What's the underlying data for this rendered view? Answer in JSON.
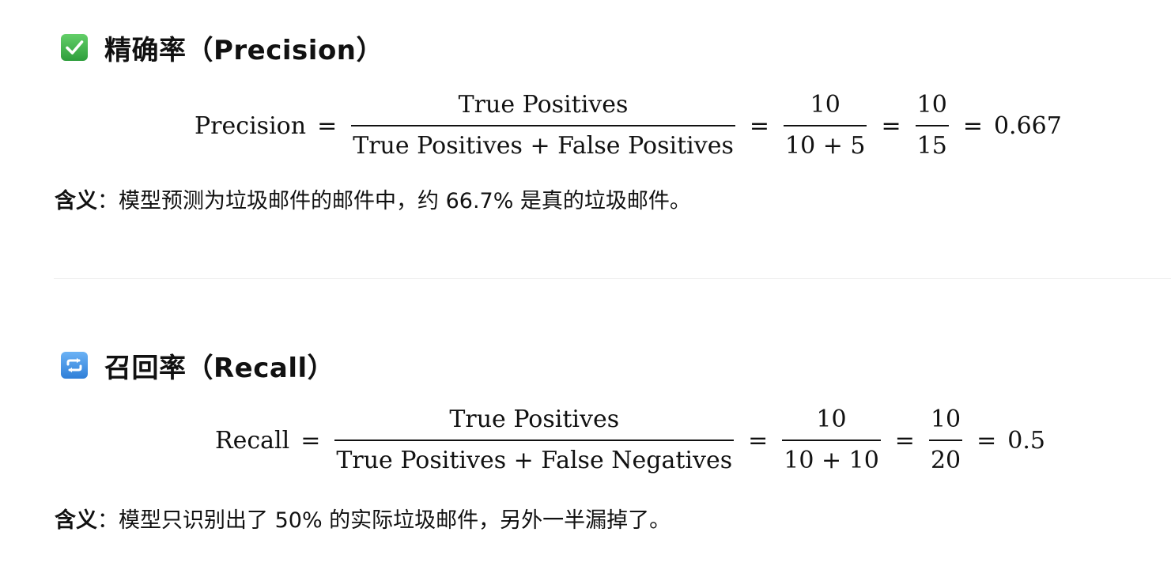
{
  "precision": {
    "heading": "精确率（Precision）",
    "icon": "check-mark-button-icon",
    "icon_color": "#3bb34a",
    "formula": {
      "lhs": "Precision",
      "eq": "=",
      "frac1_num": "True Positives",
      "frac1_den": "True Positives + False Positives",
      "frac2_num": "10",
      "frac2_den": "10 + 5",
      "frac3_num": "10",
      "frac3_den": "15",
      "result": "0.667"
    },
    "meaning_label": "含义",
    "meaning_text": "：模型预测为垃圾邮件的邮件中，约 66.7% 是真的垃圾邮件。"
  },
  "recall": {
    "heading": "召回率（Recall）",
    "icon": "repeat-arrows-button-icon",
    "icon_color": "#3d8fe6",
    "formula": {
      "lhs": "Recall",
      "eq": "=",
      "frac1_num": "True Positives",
      "frac1_den": "True Positives + False Negatives",
      "frac2_num": "10",
      "frac2_den": "10 + 10",
      "frac3_num": "10",
      "frac3_den": "20",
      "result": "0.5"
    },
    "meaning_label": "含义",
    "meaning_text": "：模型只识别出了 50% 的实际垃圾邮件，另外一半漏掉了。"
  }
}
